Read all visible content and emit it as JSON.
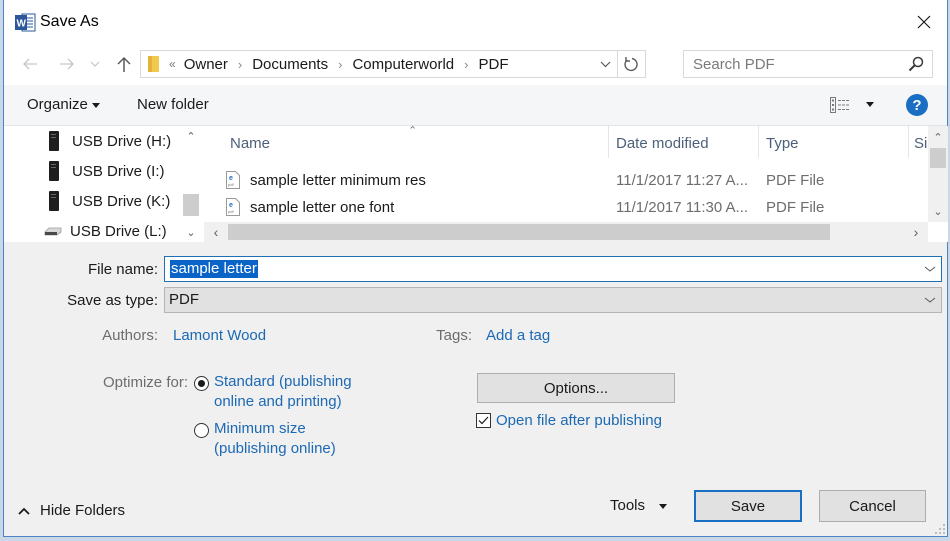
{
  "window": {
    "title": "Save As",
    "app_icon": "word-icon",
    "close_icon": "close-icon"
  },
  "nav": {
    "back_icon": "arrow-left-icon",
    "forward_icon": "arrow-right-icon",
    "recent_icon": "chevron-down-icon",
    "up_icon": "arrow-up-icon",
    "breadcrumb_overflow": "«",
    "breadcrumb": [
      "Owner",
      "Documents",
      "Computerworld",
      "PDF"
    ],
    "search_placeholder": "Search PDF"
  },
  "toolbar": {
    "organize_label": "Organize",
    "new_folder_label": "New folder",
    "view_icon": "details-view-icon",
    "help_icon": "?"
  },
  "navpane": {
    "items": [
      {
        "label": "USB Drive (H:)",
        "icon": "usb-drive-icon"
      },
      {
        "label": "USB Drive (I:)",
        "icon": "usb-drive-icon"
      },
      {
        "label": "USB Drive (K:)",
        "icon": "usb-drive-icon"
      },
      {
        "label": "USB Drive (L:)",
        "icon": "removable-drive-icon"
      }
    ]
  },
  "files": {
    "columns": [
      "Name",
      "Date modified",
      "Type",
      "Si:"
    ],
    "rows": [
      {
        "name": "sample letter minimum res",
        "date": "11/1/2017 11:27 A...",
        "type": "PDF File"
      },
      {
        "name": "sample letter one font",
        "date": "11/1/2017 11:30 A...",
        "type": "PDF File"
      }
    ]
  },
  "form": {
    "file_name_label": "File name:",
    "file_name_value": "sample letter",
    "save_type_label": "Save as type:",
    "save_type_value": "PDF",
    "authors_label": "Authors:",
    "authors_value": "Lamont Wood",
    "tags_label": "Tags:",
    "tags_value": "Add a tag",
    "optimize_label": "Optimize for:",
    "optimize_options": [
      {
        "line1": "Standard (publishing",
        "line2": "online and printing)",
        "selected": true
      },
      {
        "line1": "Minimum size",
        "line2": "(publishing online)",
        "selected": false
      }
    ],
    "options_button": "Options...",
    "open_after_label": "Open file after publishing",
    "open_after_checked": true
  },
  "footer": {
    "hide_folders_label": "Hide Folders",
    "tools_label": "Tools",
    "save_label": "Save",
    "cancel_label": "Cancel"
  },
  "colors": {
    "accent": "#1b6fc2",
    "link": "#1c69b4",
    "selection": "#0a64c8",
    "dialog_bg": "#f0f0f0"
  }
}
